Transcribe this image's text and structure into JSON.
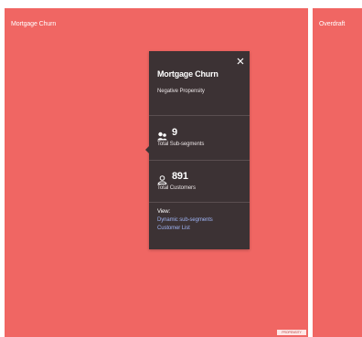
{
  "colors": {
    "tile": "#f06663",
    "tooltip_bg": "#3c3234",
    "link": "#9db2f2"
  },
  "tiles": [
    {
      "label": "Mortgage Churn",
      "tag": "PROPENSITY"
    },
    {
      "label": "Overdraft"
    }
  ],
  "tooltip": {
    "title": "Mortgage Churn",
    "subtitle": "Negative Propensity",
    "close_icon": "close-icon",
    "sub_segments": {
      "icon": "segments-icon",
      "value": "9",
      "label": "Total Sub-segments"
    },
    "customers": {
      "icon": "user-icon",
      "value": "891",
      "label": "Total Customers"
    },
    "view": {
      "label": "View:",
      "links": [
        "Dynamic sub-segments",
        "Customer List"
      ]
    }
  }
}
